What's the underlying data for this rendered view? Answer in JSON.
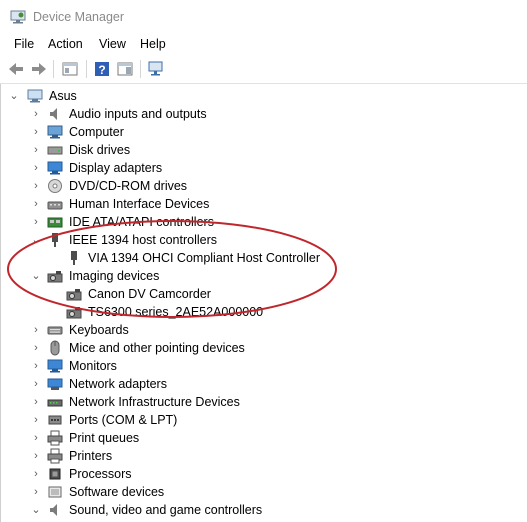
{
  "window": {
    "title": "Device Manager"
  },
  "menu": [
    "File",
    "Action",
    "View",
    "Help"
  ],
  "tree": {
    "root": "Asus",
    "categories": [
      "Audio inputs and outputs",
      "Computer",
      "Disk drives",
      "Display adapters",
      "DVD/CD-ROM drives",
      "Human Interface Devices",
      "IDE ATA/ATAPI controllers",
      "IEEE 1394 host controllers",
      "Imaging devices",
      "Keyboards",
      "Mice and other pointing devices",
      "Monitors",
      "Network adapters",
      "Network Infrastructure Devices",
      "Ports (COM & LPT)",
      "Print queues",
      "Printers",
      "Processors",
      "Software devices",
      "Sound, video and game controllers"
    ],
    "ieee_children": [
      "VIA 1394 OHCI Compliant Host Controller"
    ],
    "imaging_children": [
      "Canon DV Camcorder",
      "TS6300 series_2AE52A000000"
    ]
  },
  "colors": {
    "annotation_ellipse": "#c0272d",
    "title_text": "#8a8a8a"
  }
}
